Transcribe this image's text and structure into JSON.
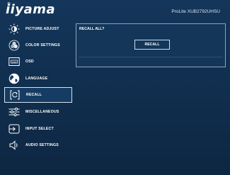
{
  "header": {
    "logo": "iiyama",
    "model": "ProLite XUB2792UHSU"
  },
  "sidebar": {
    "items": [
      {
        "label": "PICTURE ADJUST",
        "icon": "picture-adjust-icon"
      },
      {
        "label": "COLOR SETTINGS",
        "icon": "color-settings-icon"
      },
      {
        "label": "OSD",
        "icon": "osd-icon"
      },
      {
        "label": "LANGUAGE",
        "icon": "globe-icon"
      },
      {
        "label": "RECALL",
        "icon": "recall-icon",
        "selected": true
      },
      {
        "label": "MISCELLANEOUS",
        "icon": "sliders-icon"
      },
      {
        "label": "INPUT SELECT",
        "icon": "input-select-icon"
      },
      {
        "label": "AUDIO SETTINGS",
        "icon": "speaker-icon"
      }
    ]
  },
  "panel": {
    "title": "RECALL ALL?",
    "button_label": "RECALL"
  },
  "colors": {
    "background": "#102d4c",
    "highlight_border": "#d6e2ee",
    "panel_border": "#8da4bd"
  }
}
